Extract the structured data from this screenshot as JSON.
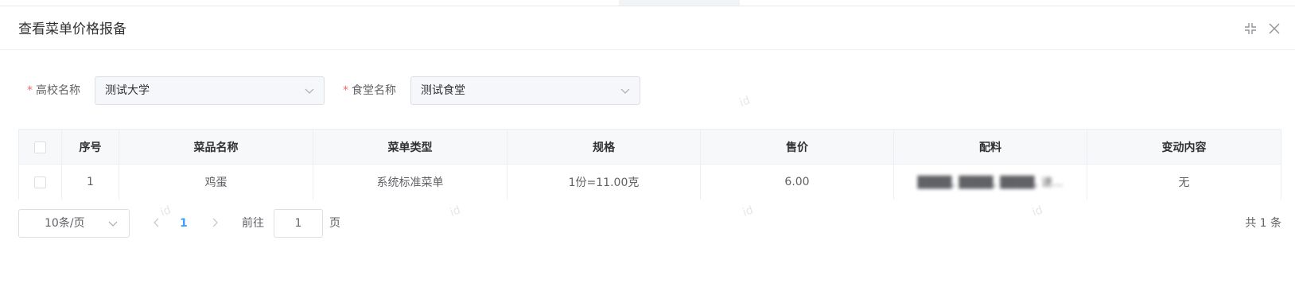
{
  "dialog": {
    "title": "查看菜单价格报备"
  },
  "filters": {
    "required_mark": "*",
    "school_label": "高校名称",
    "school_value": "测试大学",
    "canteen_label": "食堂名称",
    "canteen_value": "测试食堂"
  },
  "table": {
    "columns": [
      "序号",
      "菜品名称",
      "菜单类型",
      "规格",
      "售价",
      "配料",
      "变动内容"
    ],
    "rows": [
      {
        "index": "1",
        "dish_name": "鸡蛋",
        "menu_type": "系统标准菜单",
        "spec": "1份=11.00克",
        "price": "6.00",
        "ingredients": "████, ████, ████, 速...",
        "change": "无"
      }
    ]
  },
  "pagination": {
    "page_size": "10条/页",
    "current_page": "1",
    "goto_label": "前往",
    "goto_value": "1",
    "goto_suffix": "页",
    "total": "共 1 条"
  },
  "watermark": "id",
  "icons": {
    "minimize": "compress-icon",
    "close": "close-icon",
    "dropdown": "chevron-down-icon",
    "prev": "chevron-left-icon",
    "next": "chevron-right-icon"
  },
  "colors": {
    "required": "#f56c6c",
    "active_page": "#409eff",
    "header_bg": "#f7f8fa"
  }
}
